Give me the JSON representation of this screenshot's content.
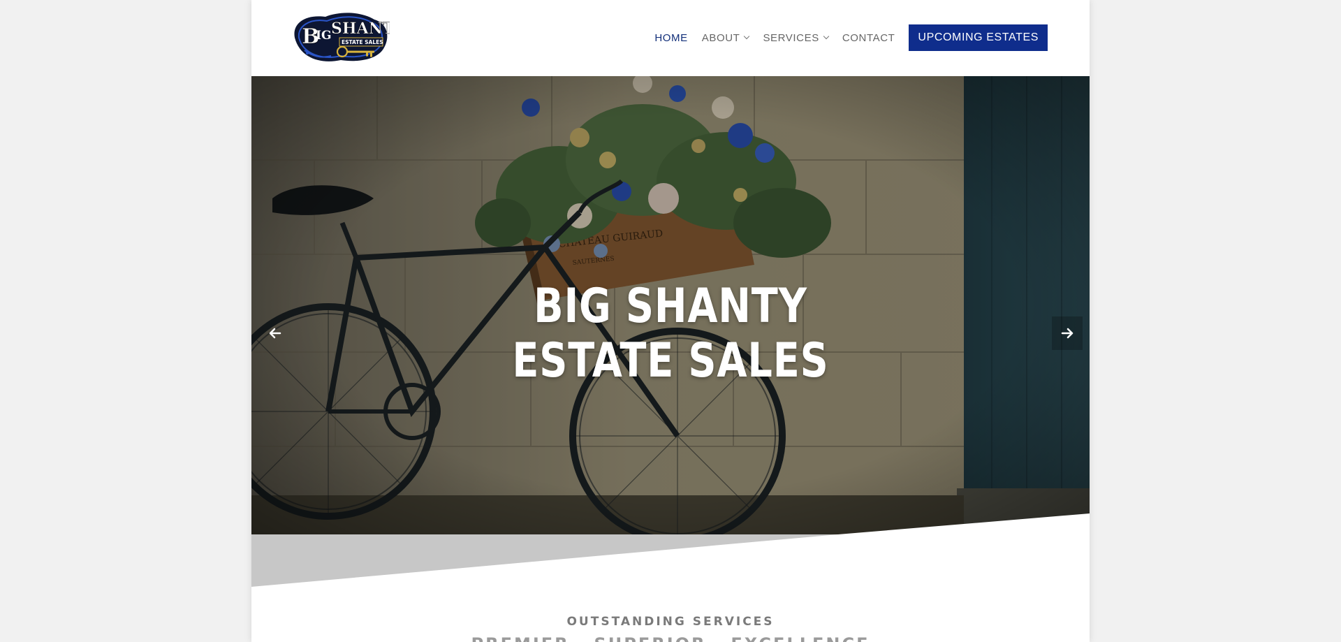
{
  "site": {
    "brand_main": "BIG SHANTY",
    "brand_sub": "ESTATE SALES",
    "accent": "#0f2d8c",
    "nav_active_color": "#13307a"
  },
  "nav": {
    "home": "HOME",
    "about": "ABOUT",
    "services": "SERVICES",
    "contact": "CONTACT",
    "cta": "UPCOMING ESTATES"
  },
  "hero": {
    "title_line1": "BIG SHANTY",
    "title_line2": "ESTATE SALES",
    "prev_icon": "arrow-left-icon",
    "next_icon": "arrow-right-icon"
  },
  "section": {
    "eyebrow": "OUTSTANDING SERVICES",
    "headline": "PREMIER · SUPERIOR · EXCELLENCE"
  }
}
